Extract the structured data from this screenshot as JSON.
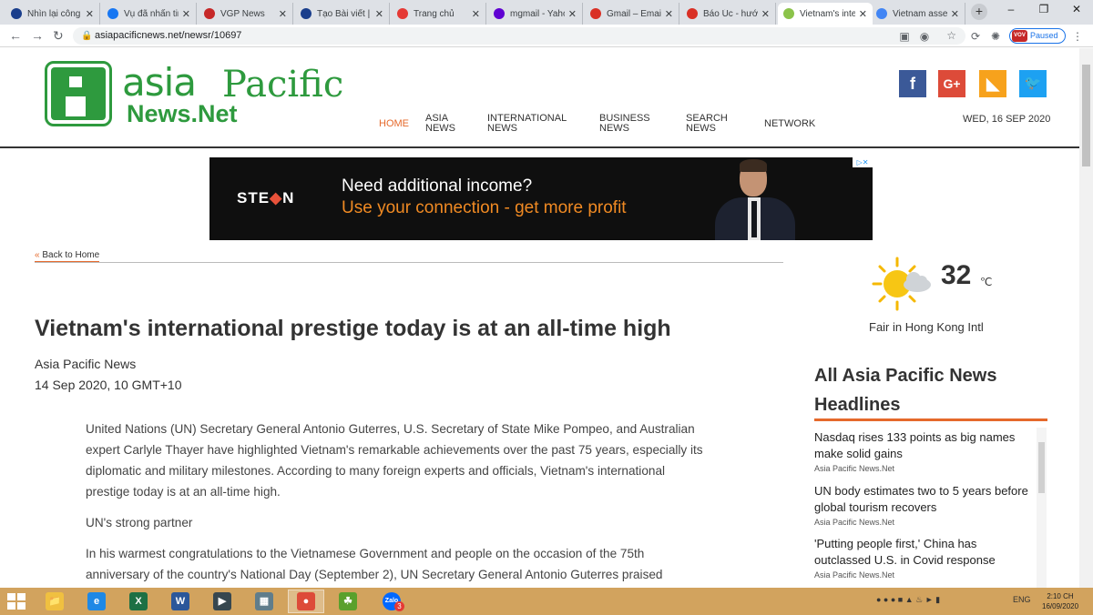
{
  "browser": {
    "tabs": [
      {
        "title": "Nhìn lại công",
        "color": "#1a3e8c"
      },
      {
        "title": "Vụ đã nhấn tin",
        "color": "#1877f2"
      },
      {
        "title": "VGP News",
        "color": "#c62828"
      },
      {
        "title": "Tạo Bài viết | V",
        "color": "#1a3e8c"
      },
      {
        "title": "Trang chủ",
        "color": "#e53935"
      },
      {
        "title": "mgmail - Yaho",
        "color": "#6001d2"
      },
      {
        "title": "Gmail – Email",
        "color": "#d93025"
      },
      {
        "title": "Báo Úc - hướ",
        "color": "#d93025"
      },
      {
        "title": "Vietnam's inte",
        "color": "#8bc34a"
      },
      {
        "title": "Vietnam asse",
        "color": "#4285f4"
      }
    ],
    "active_tab": 8,
    "url": "asiapacificnews.net/newsr/10697",
    "profile_status": "Paused",
    "profile_badge": "VOV"
  },
  "site": {
    "logo": {
      "word1": "asia",
      "word2": "Pacific",
      "word3": "News.Net"
    },
    "nav": [
      {
        "line1": "HOME",
        "line2": ""
      },
      {
        "line1": "ASIA",
        "line2": "NEWS"
      },
      {
        "line1": "INTERNATIONAL",
        "line2": "NEWS"
      },
      {
        "line1": "BUSINESS",
        "line2": "NEWS"
      },
      {
        "line1": "SEARCH",
        "line2": "NEWS"
      },
      {
        "line1": "NETWORK",
        "line2": ""
      }
    ],
    "social": [
      {
        "name": "facebook",
        "glyph": "f",
        "color": "#3b5998"
      },
      {
        "name": "google-plus",
        "glyph": "G+",
        "color": "#dd4b39"
      },
      {
        "name": "rss",
        "glyph": "◣",
        "color": "#f7a21c"
      },
      {
        "name": "twitter",
        "glyph": "🐦",
        "color": "#1da1f2"
      }
    ],
    "date": "WED, 16 SEP 2020"
  },
  "ad": {
    "brand_a": "STE",
    "brand_b": "N",
    "headline": "Need additional income?",
    "subline": "Use your connection - get more profit"
  },
  "article": {
    "back_label": "Back to Home",
    "title": "Vietnam's international prestige today is at an all-time high",
    "source": "Asia Pacific News",
    "date": "14 Sep 2020, 10 GMT+10",
    "paragraphs": [
      {
        "text": "United Nations (UN) Secretary General Antonio Guterres, U.S. Secretary of State Mike Pompeo, and Australian expert Carlyle Thayer have highlighted Vietnam's remarkable achievements over the past 75 years, especially its diplomatic and military milestones. According to many foreign experts and officials, Vietnam's international prestige today is at an all-time high."
      },
      {
        "text": "UN's strong partner"
      },
      {
        "text": "In his warmest congratulations to the Vietnamese Government and people on the occasion of the 75th anniversary of the country's National Day (September 2), UN Secretary General Antonio Guterres praised"
      }
    ]
  },
  "weather": {
    "temp": "32",
    "unit": "℃",
    "description": "Fair in Hong Kong Intl"
  },
  "headlines": {
    "title": "All Asia Pacific News Headlines",
    "items": [
      {
        "title": "Nasdaq rises 133 points as big names make solid gains",
        "source": "Asia Pacific News.Net"
      },
      {
        "title": "UN body estimates two to 5 years before global tourism recovers",
        "source": "Asia Pacific News.Net"
      },
      {
        "title": "'Putting people first,' China has outclassed U.S. in Covid response",
        "source": "Asia Pacific News.Net"
      }
    ]
  },
  "taskbar": {
    "apps": [
      {
        "name": "file-explorer",
        "glyph": "📁",
        "color": "#f0c040"
      },
      {
        "name": "internet-explorer",
        "glyph": "e",
        "color": "#1e88e5"
      },
      {
        "name": "excel",
        "glyph": "X",
        "color": "#1d7044"
      },
      {
        "name": "word",
        "glyph": "W",
        "color": "#2b579a"
      },
      {
        "name": "media-player",
        "glyph": "▶",
        "color": "#37474f"
      },
      {
        "name": "calculator",
        "glyph": "▦",
        "color": "#607d8b"
      },
      {
        "name": "chrome",
        "glyph": "●",
        "color": "#dd4b39"
      },
      {
        "name": "coccoc",
        "glyph": "☘",
        "color": "#5aa02c"
      },
      {
        "name": "zalo",
        "glyph": "Zalo",
        "color": "#0068ff"
      }
    ],
    "zalo_badge": "3",
    "language": "ENG",
    "time": "2:10 CH",
    "date": "16/09/2020"
  }
}
